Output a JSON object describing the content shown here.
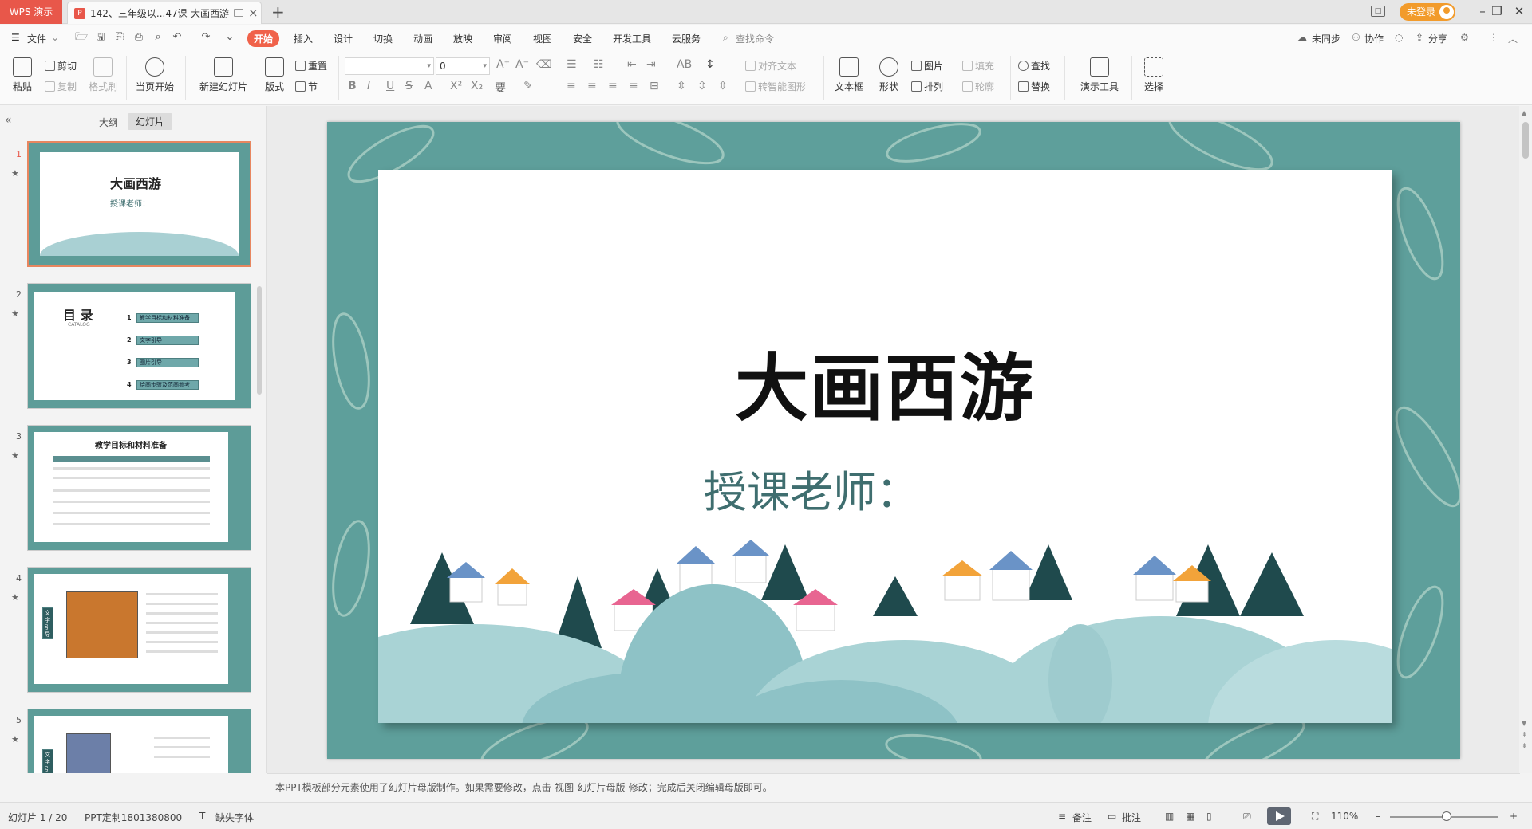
{
  "app": {
    "logo": "WPS 演示",
    "doc_tab_title": "142、三年级以...47课-大画西游",
    "doc_icon": "P"
  },
  "window": {
    "login": "未登录",
    "reader_glyph": "□",
    "min": "–",
    "restore": "❐",
    "close": "✕"
  },
  "menu": {
    "file": "文件",
    "tabs": [
      "开始",
      "插入",
      "设计",
      "切换",
      "动画",
      "放映",
      "审阅",
      "视图",
      "安全",
      "开发工具",
      "云服务"
    ],
    "active_tab": "开始",
    "search": "查找命令",
    "right": {
      "sync": "未同步",
      "collab": "协作",
      "share": "分享"
    }
  },
  "ribbon": {
    "paste": "粘贴",
    "cut": "剪切",
    "copy": "复制",
    "format_painter": "格式刷",
    "from_current": "当页开始",
    "new_slide": "新建幻灯片",
    "layout": "版式",
    "reset": "重置",
    "section": "节",
    "font_size_value": "0",
    "align_text": "对齐文本",
    "smart_art": "转智能图形",
    "textbox": "文本框",
    "shape": "形状",
    "picture": "图片",
    "arrange": "排列",
    "fill": "填充",
    "outline": "轮廓",
    "find": "查找",
    "replace": "替换",
    "present_tools": "演示工具",
    "select": "选择"
  },
  "left_panel": {
    "tab_outline": "大纲",
    "tab_slides": "幻灯片",
    "thumbs": [
      {
        "num": "1",
        "title": "大画西游",
        "subtitle": "授课老师："
      },
      {
        "num": "2",
        "title": "目 录",
        "subtitle": "CATALOG",
        "items": [
          "教学目标和材料准备",
          "文字引导",
          "图片引导",
          "绘画步骤及范画参考"
        ],
        "item_nums": [
          "1",
          "2",
          "3",
          "4"
        ]
      },
      {
        "num": "3",
        "title": "教学目标和材料准备"
      },
      {
        "num": "4",
        "label": "文字引导"
      },
      {
        "num": "5",
        "label": "文字引导"
      }
    ],
    "star": "★"
  },
  "slide": {
    "title": "大画西游",
    "teacher": "授课老师："
  },
  "notes": "本PPT模板部分元素使用了幻灯片母版制作。如果需要修改，点击-视图-幻灯片母版-修改；完成后关闭编辑母版即可。",
  "status": {
    "slide_info": "幻灯片 1 / 20",
    "template": "PPT定制1801380800",
    "missing_font": "缺失字体",
    "notes_btn": "备注",
    "comment_btn": "批注",
    "zoom": "110%",
    "zoom_minus": "–",
    "zoom_plus": "+"
  },
  "colors": {
    "accent": "#f0624a",
    "slide_bg": "#5e9f9b",
    "wps_red": "#e8574a"
  }
}
